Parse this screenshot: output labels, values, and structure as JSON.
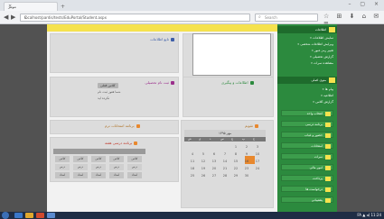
{
  "browser": {
    "tab_title": "مونتر",
    "close_tab": "×",
    "new_tab": "+",
    "window_controls": "– ▢ ×",
    "back": "◀",
    "forward": "▶",
    "url": "localhost/pardis/tests/EduPortal/Student.aspx",
    "reload": "C",
    "search_placeholder": "Search",
    "toolbar_icons": "☆ ⊞ ⬇ ⌂ ✉ ≡"
  },
  "panels": {
    "p1_title": "تابع اطلاعات",
    "p2_title": "اطلاعات و پیگیری",
    "p3_title": "ثبت نام تحصیلی",
    "p3_btn": "کلاس فعلی",
    "p3_line1": "شما هنوز ثبت نام",
    "p3_line2": "نکرده اید",
    "p4_title": "برنامه امتحانات ترم",
    "p5_title": "برنامه درسی هفته"
  },
  "schedule": {
    "rows": [
      [
        "کلاس",
        "کلاس",
        "کلاس",
        "کلاس",
        "کلاس"
      ],
      [
        "درس",
        "درس",
        "درس",
        "درس",
        "درس"
      ],
      [
        "استاد",
        "استاد",
        "استاد",
        "استاد",
        "استاد"
      ]
    ]
  },
  "calendar": {
    "title": "تقویم",
    "month": "مهر ۱۳۹۵",
    "days": [
      "ش",
      "ی",
      "د",
      "س",
      "چ",
      "پ",
      "ج"
    ],
    "weeks": [
      [
        "",
        "",
        "",
        "",
        "1",
        "2",
        "3"
      ],
      [
        "4",
        "5",
        "6",
        "7",
        "8",
        "9",
        "10"
      ],
      [
        "11",
        "12",
        "13",
        "14",
        "15",
        "16",
        "17"
      ],
      [
        "18",
        "19",
        "20",
        "21",
        "22",
        "23",
        "24"
      ],
      [
        "25",
        "26",
        "27",
        "28",
        "29",
        "30",
        ""
      ]
    ]
  },
  "sidebar": {
    "head1": "اطلاعات",
    "items1": [
      "نمایش اطلاعات",
      "ویرایش اطلاعات شخصی",
      "تغییر رمز عبور",
      "گزارش تحصیلی",
      "مشاهده نمرات"
    ],
    "head2": "منوی اصلی",
    "items2": [
      "پیام ها",
      "اطلاعیه",
      "گزارش کلاس"
    ],
    "tiles": [
      "انتخاب واحد",
      "برنامه درسی",
      "حضور و غیاب",
      "امتحانات",
      "نمرات",
      "امور مالی",
      "پرداخت",
      "درخواست ها",
      "پشتیبانی"
    ]
  },
  "taskbar": {
    "tray_text": "FA ▲ ◂) 11:24"
  },
  "colors": {
    "accent_yellow": "#f5e24e",
    "sidebar_green": "#2c8a3e",
    "today_orange": "#e8882e"
  }
}
